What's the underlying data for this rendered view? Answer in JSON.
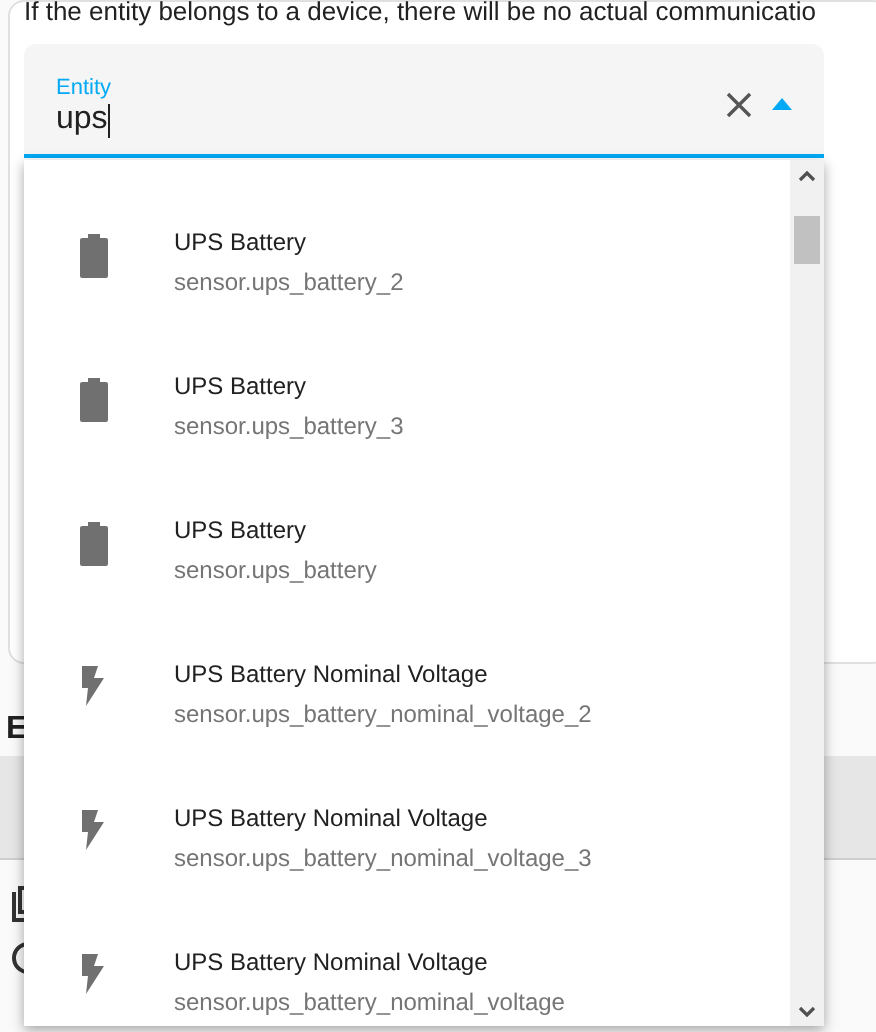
{
  "description": "If the entity belongs to a device, there will be no actual communicatio",
  "field": {
    "label": "Entity",
    "value": "ups",
    "expanded": true
  },
  "options": [
    {
      "kind": "battery",
      "name": "UPS Battery",
      "entity_id": "sensor.ups_battery_2"
    },
    {
      "kind": "battery",
      "name": "UPS Battery",
      "entity_id": "sensor.ups_battery_3"
    },
    {
      "kind": "battery",
      "name": "UPS Battery",
      "entity_id": "sensor.ups_battery"
    },
    {
      "kind": "voltage",
      "name": "UPS Battery Nominal Voltage",
      "entity_id": "sensor.ups_battery_nominal_voltage_2"
    },
    {
      "kind": "voltage",
      "name": "UPS Battery Nominal Voltage",
      "entity_id": "sensor.ups_battery_nominal_voltage_3"
    },
    {
      "kind": "voltage",
      "name": "UPS Battery Nominal Voltage",
      "entity_id": "sensor.ups_battery_nominal_voltage"
    }
  ],
  "section_heading": "E"
}
